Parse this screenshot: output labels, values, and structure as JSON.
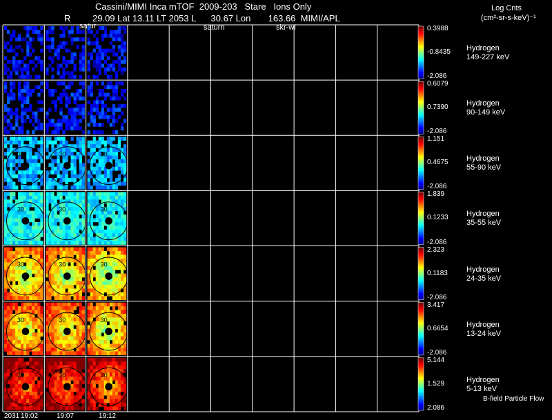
{
  "header": {
    "line1": "Cassini/MIMI Inca mTOF  2009-203   Stare   Ions Only",
    "line2_r": "R",
    "line2_vals": "29.09 Lat 13.11 LT 2053 L      30.67 Lon       163.66  MIMI/APL",
    "saturn_label_1": "satur",
    "saturn_label_2": "saturn",
    "frame_label": "skr-wl",
    "units_title": "Log Cnts",
    "units": "(cm²-sr-s-keV)⁻¹"
  },
  "rows": [
    {
      "ion": "Hydrogen",
      "energy": "149-227 keV",
      "max": "0.3988",
      "mid": "-0.8435",
      "min": "-2.086",
      "level": 0.12
    },
    {
      "ion": "Hydrogen",
      "energy": "90-149 keV",
      "max": "0.6079",
      "mid": "0.7390",
      "min": "-2.086",
      "level": 0.14
    },
    {
      "ion": "Hydrogen",
      "energy": "55-90 keV",
      "max": "1.151",
      "mid": "0.4675",
      "min": "-2.086",
      "level": 0.3
    },
    {
      "ion": "Hydrogen",
      "energy": "35-55 keV",
      "max": "1.839",
      "mid": "0.1233",
      "min": "-2.086",
      "level": 0.38
    },
    {
      "ion": "Hydrogen",
      "energy": "24-35 keV",
      "max": "2.323",
      "mid": "0.1183",
      "min": "-2.086",
      "level": 0.5
    },
    {
      "ion": "Hydrogen",
      "energy": "13-24 keV",
      "max": "3.417",
      "mid": "0.6654",
      "min": "-2.086",
      "level": 0.55
    },
    {
      "ion": "Hydrogen",
      "energy": "5-13 keV",
      "max": "5.144",
      "mid": "1.529",
      "min": "2.086",
      "level": 0.72
    }
  ],
  "times": [
    "2031",
    "19:02",
    "19:07",
    "19:12"
  ],
  "footer_note": "B-field Particle Flow",
  "ring_label": "30"
}
